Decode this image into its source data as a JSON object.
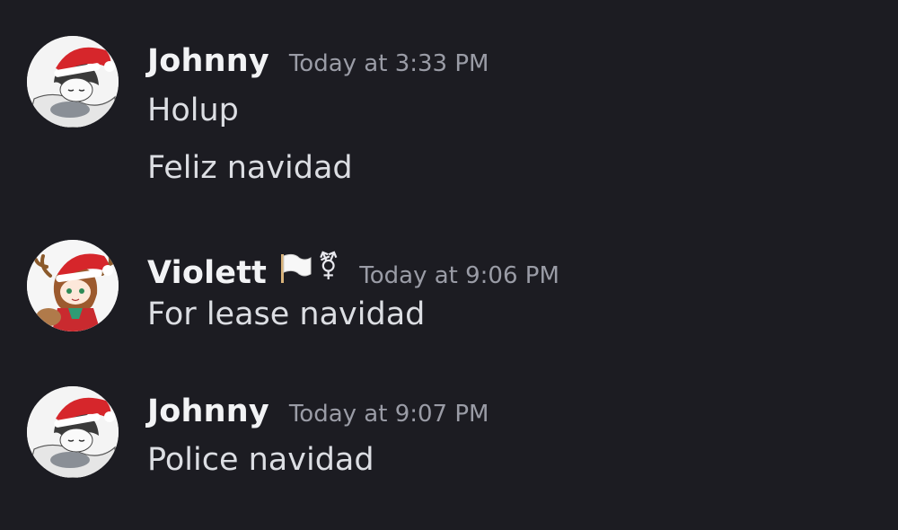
{
  "messages": [
    {
      "username": "Johnny",
      "timestamp": "Today at 3:33 PM",
      "avatar": "santa-hat-sleeping-character",
      "lines": [
        "Holup",
        "Feliz navidad"
      ]
    },
    {
      "username": "Violett",
      "badges": [
        "white-flag-icon",
        "transgender-symbol-icon"
      ],
      "badge_glyph": "⚧",
      "timestamp": "Today at 9:06 PM",
      "avatar": "santa-hat-reindeer-girl",
      "lines": [
        "For lease navidad"
      ]
    },
    {
      "username": "Johnny",
      "timestamp": "Today at 9:07 PM",
      "avatar": "santa-hat-sleeping-character",
      "lines": [
        "Police navidad"
      ]
    }
  ],
  "colors": {
    "background": "#1c1c22",
    "username": "#f2f3f5",
    "timestamp": "#9a9ca6",
    "message_text": "#dcdee3"
  }
}
